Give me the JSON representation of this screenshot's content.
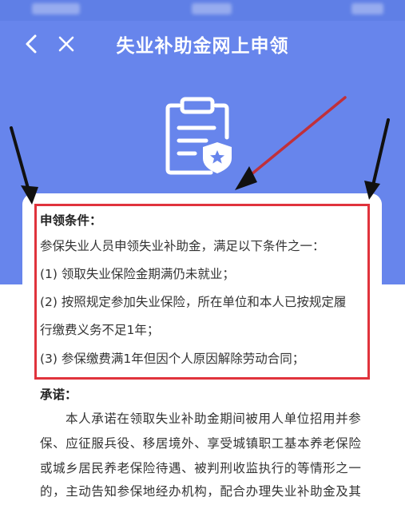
{
  "nav": {
    "title": "失业补助金网上申领",
    "back_icon": "chevron-left-icon",
    "close_icon": "close-icon"
  },
  "hero": {
    "icon": "clipboard-shield-icon"
  },
  "conditions": {
    "heading": "申领条件：",
    "intro": "参保失业人员申领失业补助金，满足以下条件之一：",
    "item1": "(1) 领取失业保险金期满仍未就业；",
    "item2_line1": "(2) 按照规定参加失业保险，所在单位和本人已按规定履",
    "item2_line2": "行缴费义务不足1年；",
    "item3": "(3) 参保缴费满1年但因个人原因解除劳动合同；"
  },
  "pledge": {
    "heading": "承诺：",
    "line1": "本人承诺在领取失业补助金期间被用人单位招用并参",
    "line2": "保、应征服兵役、移居境外、享受城镇职工基本养老保险",
    "line3": "或城乡居民养老保险待遇、被判刑收监执行的等情形之一",
    "line4": "的，主动告知参保地经办机构，配合办理失业补助金及其"
  },
  "colors": {
    "header_bg": "#6785ec",
    "highlight_border": "#e0333c",
    "annotation_arrow_black": "#111111",
    "annotation_arrow_red": "#c0303a"
  }
}
